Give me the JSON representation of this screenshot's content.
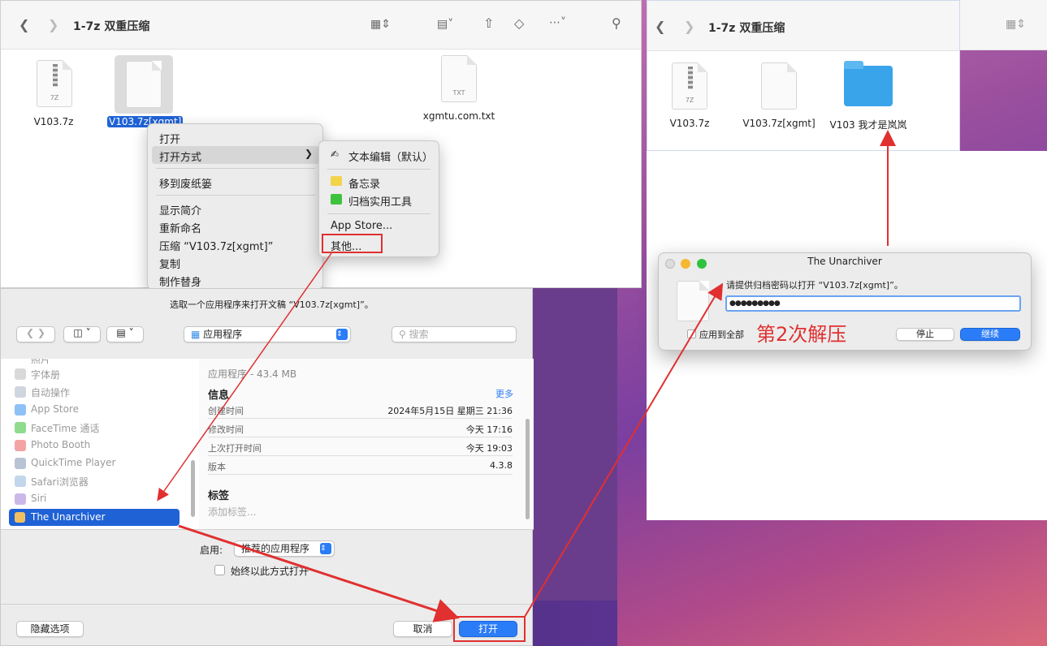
{
  "finder1": {
    "title": "1-7z 双重压缩",
    "files": [
      {
        "name": "V103.7z",
        "tag": "7Z"
      },
      {
        "name": "V103.7z[xgmt]",
        "tag": ""
      },
      {
        "name": "xgmtu.com.txt",
        "tag": "TXT"
      }
    ]
  },
  "context_menu": {
    "items": [
      "打开",
      "打开方式",
      "移到废纸篓",
      "显示简介",
      "重新命名",
      "压缩 “V103.7z[xgmt]”",
      "复制",
      "制作替身"
    ]
  },
  "open_with_menu": {
    "items": [
      "文本编辑（默认）",
      "备忘录",
      "归档实用工具",
      "App Store...",
      "其他..."
    ]
  },
  "chooser": {
    "prompt": "选取一个应用程序来打开文稿 “V103.7z[xgmt]”。",
    "location": "应用程序",
    "search_placeholder": "搜索",
    "apps": [
      "字体册",
      "自动操作",
      "App Store",
      "FaceTime 通话",
      "Photo Booth",
      "QuickTime Player",
      "Safari浏览器",
      "Siri",
      "The Unarchiver"
    ],
    "partial_label": "照片",
    "info": {
      "summary": "应用程序 - 43.4 MB",
      "section": "信息",
      "more": "更多",
      "rows": [
        {
          "k": "创建时间",
          "v": "2024年5月15日 星期三 21:36"
        },
        {
          "k": "修改时间",
          "v": "今天 17:16"
        },
        {
          "k": "上次打开时间",
          "v": "今天 19:03"
        },
        {
          "k": "版本",
          "v": "4.3.8"
        }
      ],
      "tags_title": "标签",
      "tags_placeholder": "添加标签..."
    },
    "enable_label": "启用:",
    "enable_value": "推荐的应用程序",
    "always_label": "始终以此方式打开",
    "hide_options": "隐藏选项",
    "cancel": "取消",
    "open": "打开"
  },
  "finder2": {
    "title": "1-7z 双重压缩",
    "files": [
      {
        "name": "V103.7z",
        "tag": "7Z"
      },
      {
        "name": "V103.7z[xgmt]"
      },
      {
        "name": "V103 我才是岚岚"
      }
    ]
  },
  "unarchiver": {
    "title": "The Unarchiver",
    "message": "请提供归档密码以打开 “V103.7z[xgmt]”。",
    "password_mask": "●●●●●●●●●",
    "apply_all": "应用到全部",
    "stop": "停止",
    "continue": "继续"
  },
  "annotation": "第2次解压",
  "colors": {
    "accent": "#2b7cf7",
    "annotation": "#e03030",
    "selection": "#1f62d6"
  }
}
